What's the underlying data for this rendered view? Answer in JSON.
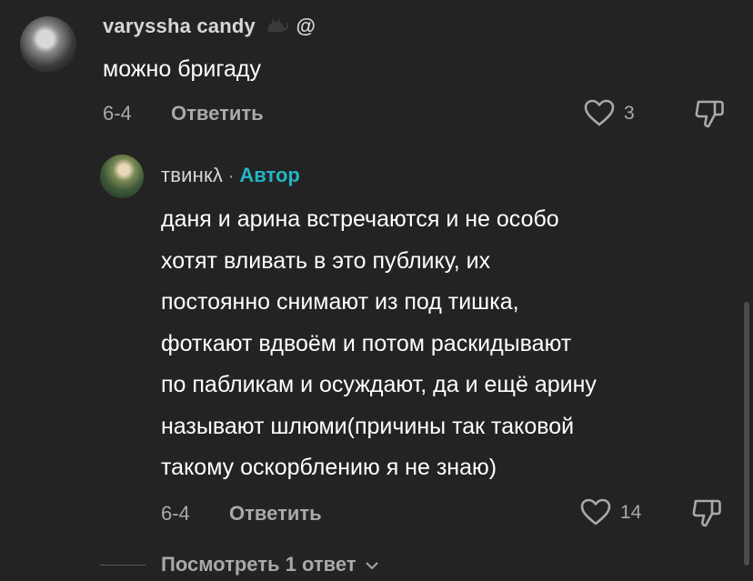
{
  "comment1": {
    "username": "varyssha candy",
    "username_suffix": "@",
    "text": "можно бригаду",
    "date": "6-4",
    "reply_label": "Ответить",
    "like_count": "3"
  },
  "comment2": {
    "username": "твинкλ",
    "separator": "·",
    "author_badge": "Автор",
    "text_lines": [
      "даня и арина встречаются и не особо",
      "хотят вливать в это публику, их",
      "постоянно снимают из под тишка,",
      "фоткают вдвоём и потом раскидывают",
      "по пабликам и осуждают, да и ещё арину",
      "называют шлюми(причины так таковой",
      "такому оскорблению я не знаю)"
    ],
    "date": "6-4",
    "reply_label": "Ответить",
    "like_count": "14"
  },
  "view_replies_label": "Посмотреть 1 ответ",
  "colors": {
    "background": "#232323",
    "author_accent": "#25b4c4",
    "secondary_text": "#a9a9a9"
  }
}
